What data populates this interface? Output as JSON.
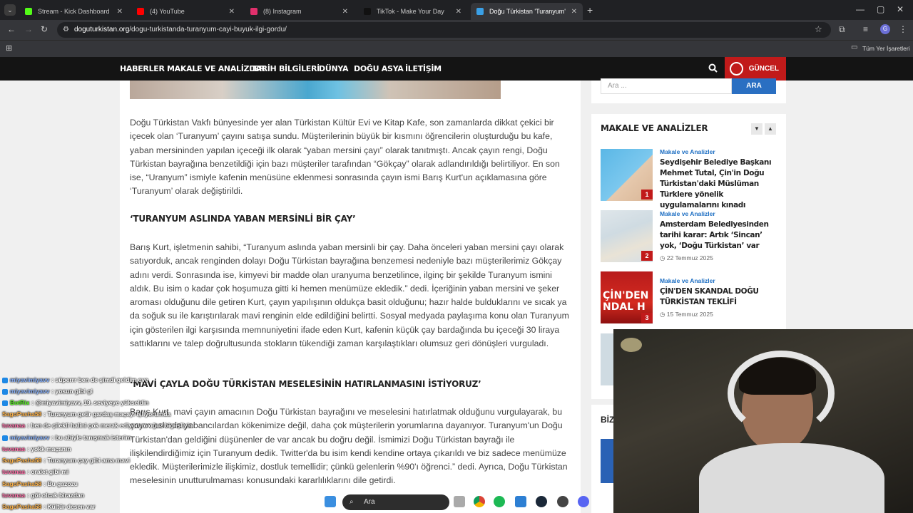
{
  "browser": {
    "tabs": [
      {
        "label": "Stream - Kick Dashboard",
        "color": "#53fc18"
      },
      {
        "label": "(4) YouTube",
        "color": "#ff0000"
      },
      {
        "label": "(8) Instagram",
        "color": "#e1306c"
      },
      {
        "label": "TikTok - Make Your Day",
        "color": "#111111"
      },
      {
        "label": "Doğu Türkistan 'Turanyum' çayı",
        "color": "#3aa0e6"
      }
    ],
    "url_domain": "doguturkistan.org",
    "url_path": "/dogu-turkistanda-turanyum-cayi-buyuk-ilgi-gordu/",
    "bookmarks_label": "Tüm Yer İşaretleri"
  },
  "nav": {
    "items": [
      "HABERLER",
      "MAKALE VE ANALİZLER",
      "TARİH BİLGİLERİ",
      "DÜNYA",
      "DOĞU ASYA",
      "İLETİŞİM"
    ],
    "guncel": "GÜNCEL"
  },
  "article": {
    "p1": "Doğu Türkistan Vakfı bünyesinde yer alan Türkistan Kültür Evi ve Kitap Kafe, son zamanlarda dikkat çekici bir içecek olan ‘Turanyum’ çayını satışa sundu. Müşterilerinin büyük bir kısmını öğrencilerin oluşturduğu bu kafe, yaban mersininden yapılan içeceği ilk olarak “yaban mersini çayı” olarak tanıtmıştı. Ancak çayın rengi, Doğu Türkistan bayrağına benzetildiği için bazı müşteriler tarafından “Gökçay” olarak adlandırıldığı belirtiliyor. En son ise, “Uranyum” ismiyle kafenin menüsüne eklenmesi sonrasında çayın ismi Barış Kurt'un açıklamasına göre ‘Turanyum’ olarak değiştirildi.",
    "h1": "‘TURANYUM ASLINDA YABAN MERSİNLİ BİR ÇAY’",
    "p2": "Barış Kurt, işletmenin sahibi, “Turanyum aslında yaban mersinli bir çay. Daha önceleri yaban mersini çayı olarak satıyorduk, ancak renginden dolayı Doğu Türkistan bayrağına benzemesi nedeniyle bazı müşterilerimiz Gökçay adını verdi. Sonrasında ise, kimyevi bir madde olan uranyuma benzetilince, ilginç bir şekilde Turanyum ismini aldık. Bu isim o kadar çok hoşumuza gitti ki hemen menümüze ekledik.” dedi. İçeriğinin yaban mersini ve şeker aroması olduğunu dile getiren Kurt, çayın yapılışının oldukça basit olduğunu; hazır halde bulduklarını ve sıcak ya da soğuk su ile karıştırılarak mavi renginin elde edildiğini belirtti. Sosyal medyada paylaşıma konu olan Turanyum için gösterilen ilgi karşısında memnuniyetini ifade eden Kurt, kafenin küçük çay bardağında bu içeceği 30 liraya sattıklarını ve talep doğrultusunda stokların tükendiği zaman karşılaştıkları olumsuz geri dönüşleri vurguladı.",
    "h2": "‘MAVİ ÇAYLA DOĞU TÜRKİSTAN MESELESİNİN HATIRLANMASINI İSTİYORUZ’",
    "p3": "Barış Kurt, mavi çayın amacının Doğu Türkistan bayrağını ve meselesini hatırlatmak olduğunu vurgulayarak, bu çayın aslında yabancılardan kökenimize değil, daha çok müşterilerin yorumlarına dayanıyor. Turanyum'un Doğu Türkistan'dan geldiğini düşünenler de var ancak bu doğru değil. İsmimizi Doğu Türkistan bayrağı ile ilişkilendirdiğimiz için Turanyum dedik. Twitter'da bu isim kendi kendine ortaya çıkarıldı ve biz sadece menümüze ekledik. Müşterilerimizle ilişkimiz, dostluk temellidir; çünkü gelenlerin %90'ı öğrenci.” dedi. Ayrıca, Doğu Türkistan meselesinin unutturulmaması konusundaki kararlılıklarını dile getirdi."
  },
  "sidebar": {
    "search_placeholder": "Ara ...",
    "search_button": "ARA",
    "title": "MAKALE VE ANALİZLER",
    "posts": [
      {
        "rank": "1",
        "category": "Makale ve Analizler",
        "title": "Seydişehir Belediye Başkanı Mehmet Tutal, Çin'in Doğu Türkistan'daki Müslüman Türklere yönelik uygulamalarını kınadı",
        "date": ""
      },
      {
        "rank": "2",
        "category": "Makale ve Analizler",
        "title": "Amsterdam Belediyesinden tarihi karar: Artık ‘Sincan’ yok, ‘Doğu Türkistan’ var",
        "date": "22 Temmuz 2025"
      },
      {
        "rank": "3",
        "category": "Makale ve Analizler",
        "title": "ÇİN'DEN SKANDAL DOĞU TÜRKİSTAN TEKLİFİ",
        "date": "15 Temmuz 2025",
        "thumb_text": "ÇİN'DEN NDAL H"
      }
    ],
    "biz": "BİZ"
  },
  "chat": [
    {
      "user": "miyavimiyavv",
      "msg": ": süperrr ben de şimdi geldim eve",
      "color": "#8ab4ff",
      "badge": true
    },
    {
      "user": "miyavimiyavv",
      "msg": ": yosun gibi gi",
      "color": "#8ab4ff",
      "badge": true
    },
    {
      "user": "BotRix",
      "msg": ": @miyavimiyavv, 19. seviyeye yükseldin",
      "color": "#53fc18",
      "badge": true
    },
    {
      "user": "SagoPasha58",
      "msg": ": Turanyum getir gardaş maçayı işliyorumda",
      "color": "#ffb347",
      "badge": false
    },
    {
      "user": "tuvanaa",
      "msg": ": ben de çilekli halini çok merak ediyorum oğuz big işliyin",
      "color": "#ff6fa8",
      "badge": false
    },
    {
      "user": "miyavimiyavv",
      "msg": ": bu abiyle tanışmak isterim",
      "color": "#8ab4ff",
      "badge": true
    },
    {
      "user": "tuvanaa",
      "msg": ": yokk maçanın",
      "color": "#ff6fa8",
      "badge": false
    },
    {
      "user": "SagoPasha58",
      "msg": ": Turanyum çay gibi ama mavi",
      "color": "#ffb347",
      "badge": false
    },
    {
      "user": "tuvanaa",
      "msg": ": oralet gibi mi",
      "color": "#ff6fa8",
      "badge": false
    },
    {
      "user": "SagoPasha58",
      "msg": ": Bu gazozu",
      "color": "#ffb347",
      "badge": false
    },
    {
      "user": "tuvanaa",
      "msg": ": göt olcak birazdan",
      "color": "#ff6fa8",
      "badge": false
    },
    {
      "user": "SagoPasha58",
      "msg": ": Kültür desen var",
      "color": "#ffb347",
      "badge": false
    }
  ],
  "taskbar": {
    "search": "Ara"
  }
}
